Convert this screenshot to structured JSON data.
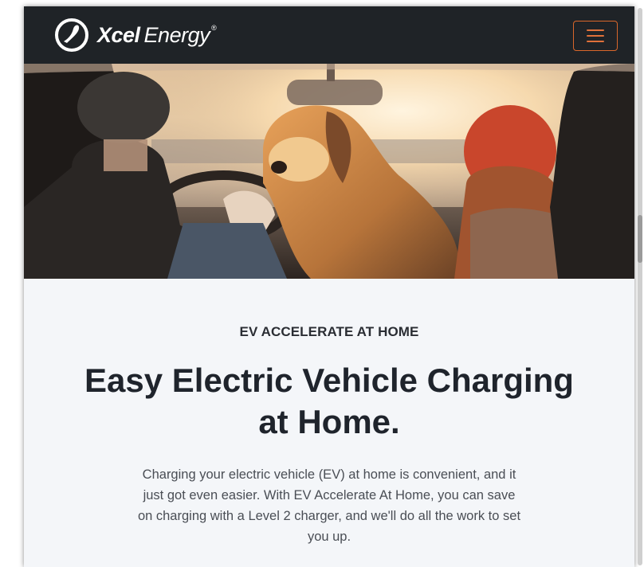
{
  "header": {
    "logo_bold": "Xcel",
    "logo_light": "Energy",
    "logo_reg": "®",
    "menu_icon": "hamburger-menu-icon"
  },
  "hero": {
    "image": "family-with-dog-in-car-photo"
  },
  "content": {
    "eyebrow": "EV ACCELERATE AT HOME",
    "headline": "Easy Electric Vehicle Charging at Home.",
    "body": "Charging your electric vehicle (EV) at home is convenient, and it just got even easier. With EV Accelerate At Home, you can save on charging with a Level 2 charger, and we'll do all the work to set you up."
  },
  "colors": {
    "header_bg": "#1f2327",
    "accent_orange": "#d9672b",
    "page_bg": "#f4f6f9",
    "headline_text": "#1f242c"
  }
}
